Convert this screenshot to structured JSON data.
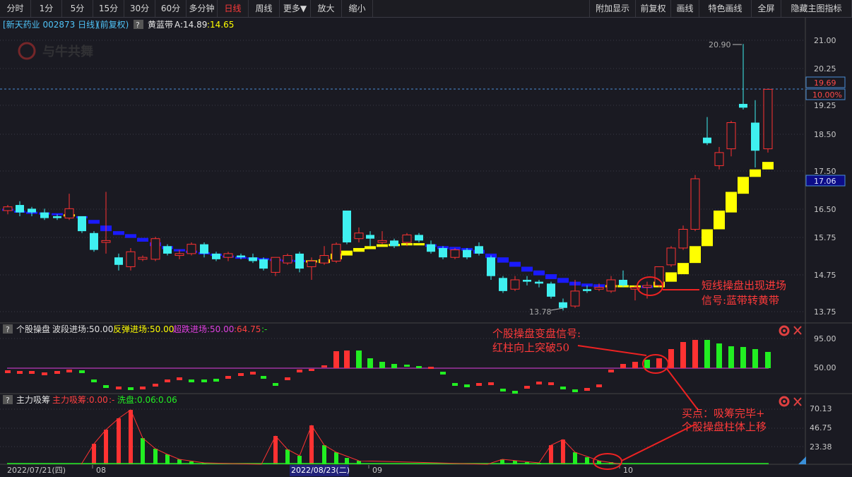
{
  "toolbar": {
    "left": [
      "分时",
      "1分",
      "5分",
      "15分",
      "30分",
      "60分",
      "多分钟",
      "日线",
      "周线",
      "更多▼",
      "放大",
      "缩小"
    ],
    "active": "日线",
    "right": [
      "附加显示",
      "前复权",
      "画线",
      "特色画线",
      "全屏",
      "隐藏主图指标"
    ]
  },
  "main_header": {
    "stock": "[新天药业 002873 日线]",
    "adjust": "(前复权)",
    "q": "?",
    "indicator": "黄蓝带",
    "a_label": "A:14.89",
    "a2_label": ":14.65"
  },
  "logo_text": "与牛共舞",
  "price_axis": [
    "21.00",
    "20.25",
    "19.25",
    "18.50",
    "17.50",
    "16.50",
    "15.75",
    "14.75",
    "13.75"
  ],
  "price_labels": {
    "current": "19.69",
    "pct": "10.00%",
    "level": "17.06",
    "high": "20.90",
    "low": "13.78"
  },
  "sub1_header": {
    "q": "?",
    "name": "个股操盘",
    "a": "波段进场:50.00",
    "b": "反弹进场:50.00",
    "c": "超跌进场:50.00",
    "d": ":64.75",
    "e": ":-"
  },
  "sub1_axis": [
    "95.00",
    "50.00"
  ],
  "sub2_header": {
    "q": "?",
    "name": "主力吸筹",
    "a": "主力吸筹:0.00",
    "b": ":-",
    "c": "洗盘:0.06",
    "d": ":0.06"
  },
  "sub2_axis": [
    "70.13",
    "46.75",
    "23.38"
  ],
  "dates": {
    "d1": "2022/07/21(四)",
    "m8": "08",
    "d2": "2022/08/23(二)",
    "m9": "09",
    "m10": "10"
  },
  "annotations": {
    "a1_l1": "短线操盘出现进场",
    "a1_l2": "信号:蓝带转黄带",
    "a2_l1": "个股操盘变盘信号:",
    "a2_l2": "红柱向上突破50",
    "a3_l1": "买点：吸筹完毕+",
    "a3_l2": "个股操盘柱体上移"
  },
  "colors": {
    "up": "#ff3232",
    "down": "#3ff0f0",
    "blue_band": "#1a1aff",
    "yellow_band": "#ffff00",
    "magenta": "#e040e0",
    "green": "#22ee22"
  }
}
